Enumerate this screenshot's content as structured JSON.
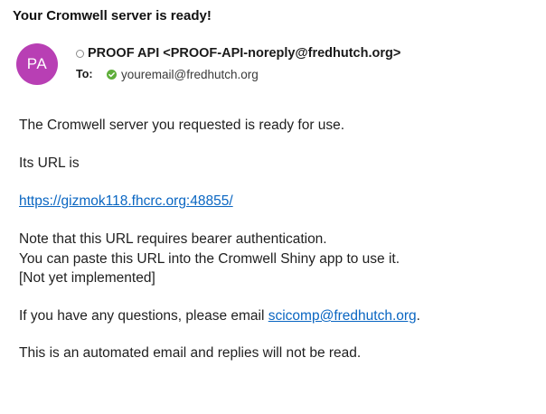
{
  "email": {
    "subject": "Your Cromwell server is ready!",
    "sender": {
      "initials": "PA",
      "avatar_color": "#b83fb4",
      "display": "PROOF API <PROOF-API-noreply@fredhutch.org>"
    },
    "to": {
      "label": "To:",
      "address": "youremail@fredhutch.org"
    },
    "body": {
      "intro": "The Cromwell server you requested is ready for use.",
      "url_intro": "Its URL is",
      "url": "https://gizmok118.fhcrc.org:48855/",
      "note_line1": "Note that this URL requires bearer authentication.",
      "note_line2": "You can paste this URL into the Cromwell Shiny app to use it.",
      "note_line3": "[Not yet implemented]",
      "questions_prefix": "If you have any questions, please email ",
      "contact_email": "scicomp@fredhutch.org",
      "questions_suffix": ".",
      "footer": "This is an automated email and replies will not be read."
    }
  },
  "colors": {
    "link": "#0a66c2",
    "presence_available": "#5fae3a"
  }
}
